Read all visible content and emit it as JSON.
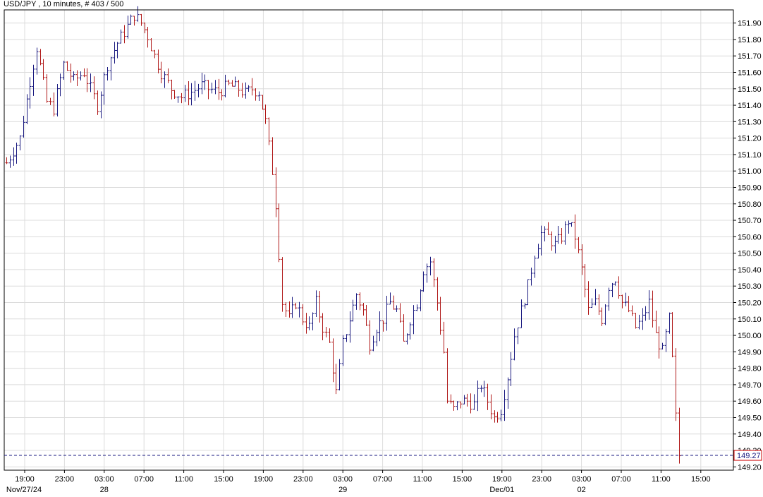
{
  "header": {
    "symbol": "USD/JPY",
    "interval": "10 minutes",
    "count_label": "# 403 / 500",
    "title_text": "USD/JPY , 10 minutes, # 403 / 500"
  },
  "colors": {
    "background": "#ffffff",
    "grid": "#dcdcdc",
    "up_bar": "#1a1a80",
    "down_bar": "#b01818",
    "price_line": "#1a1a80",
    "price_box_border": "#cc0000",
    "price_box_text": "#1a1a80",
    "axis_text": "#000000"
  },
  "current_price": {
    "value": 149.27,
    "label": "149.27"
  },
  "chart_data": {
    "type": "ohlc",
    "title": "USD/JPY , 10 minutes, # 403 / 500",
    "ylim": [
      149.18,
      151.98
    ],
    "y_ticks": [
      151.9,
      151.8,
      151.7,
      151.6,
      151.5,
      151.4,
      151.3,
      151.2,
      151.1,
      151.0,
      150.9,
      150.8,
      150.7,
      150.6,
      150.5,
      150.4,
      150.3,
      150.2,
      150.1,
      150.0,
      149.9,
      149.8,
      149.7,
      149.6,
      149.5,
      149.4,
      149.3,
      149.2
    ],
    "y_tick_labels": [
      "151.90",
      "151.80",
      "151.70",
      "151.60",
      "151.50",
      "151.40",
      "151.30",
      "151.20",
      "151.10",
      "151.00",
      "150.90",
      "150.80",
      "150.70",
      "150.60",
      "150.50",
      "150.40",
      "150.30",
      "150.20",
      "150.10",
      "150.00",
      "149.90",
      "149.80",
      "149.70",
      "149.60",
      "149.50",
      "149.40",
      "149.30",
      "149.20"
    ],
    "x_time_labels": [
      "19:00",
      "23:00",
      "03:00",
      "07:00",
      "11:00",
      "15:00",
      "19:00",
      "23:00",
      "03:00",
      "07:00",
      "11:00",
      "15:00",
      "19:00",
      "23:00",
      "03:00",
      "07:00",
      "11:00",
      "15:00"
    ],
    "x_date_labels": [
      {
        "label": "Nov/27/24",
        "slot": 0
      },
      {
        "label": "28",
        "slot": 2
      },
      {
        "label": "29",
        "slot": 8
      },
      {
        "label": "Dec/01",
        "slot": 12
      },
      {
        "label": "02",
        "slot": 14
      }
    ],
    "grid": true,
    "path": [
      [
        0,
        151.05
      ],
      [
        4,
        151.2
      ],
      [
        7,
        151.55
      ],
      [
        9,
        151.75
      ],
      [
        12,
        151.42
      ],
      [
        14,
        151.38
      ],
      [
        17,
        151.65
      ],
      [
        20,
        151.55
      ],
      [
        23,
        151.6
      ],
      [
        27,
        151.4
      ],
      [
        30,
        151.65
      ],
      [
        33,
        151.78
      ],
      [
        36,
        151.88
      ],
      [
        38,
        151.95
      ],
      [
        40,
        151.9
      ],
      [
        42,
        151.82
      ],
      [
        44,
        151.7
      ],
      [
        46,
        151.6
      ],
      [
        49,
        151.5
      ],
      [
        52,
        151.45
      ],
      [
        55,
        151.48
      ],
      [
        58,
        151.52
      ],
      [
        60,
        151.5
      ],
      [
        63,
        151.48
      ],
      [
        66,
        151.52
      ],
      [
        69,
        151.5
      ],
      [
        71,
        151.47
      ],
      [
        73,
        151.5
      ],
      [
        75,
        151.48
      ],
      [
        77,
        151.3
      ],
      [
        79,
        151.0
      ],
      [
        80,
        150.8
      ],
      [
        81,
        150.5
      ],
      [
        82,
        150.2
      ],
      [
        84,
        150.1
      ],
      [
        86,
        150.2
      ],
      [
        88,
        150.1
      ],
      [
        90,
        150.05
      ],
      [
        92,
        150.2
      ],
      [
        94,
        150.05
      ],
      [
        96,
        149.95
      ],
      [
        98,
        149.65
      ],
      [
        100,
        149.95
      ],
      [
        102,
        150.1
      ],
      [
        104,
        150.25
      ],
      [
        106,
        150.15
      ],
      [
        108,
        149.95
      ],
      [
        110,
        150.05
      ],
      [
        112,
        150.1
      ],
      [
        114,
        150.2
      ],
      [
        116,
        150.15
      ],
      [
        118,
        149.95
      ],
      [
        120,
        150.1
      ],
      [
        122,
        150.2
      ],
      [
        124,
        150.4
      ],
      [
        126,
        150.45
      ],
      [
        128,
        150.2
      ],
      [
        130,
        149.9
      ],
      [
        131,
        149.6
      ],
      [
        133,
        149.55
      ],
      [
        135,
        149.6
      ],
      [
        137,
        149.6
      ],
      [
        139,
        149.58
      ],
      [
        141,
        149.7
      ],
      [
        143,
        149.6
      ],
      [
        145,
        149.5
      ],
      [
        147,
        149.55
      ],
      [
        149,
        149.75
      ],
      [
        151,
        150.0
      ],
      [
        153,
        150.15
      ],
      [
        155,
        150.3
      ],
      [
        157,
        150.5
      ],
      [
        159,
        150.62
      ],
      [
        161,
        150.6
      ],
      [
        163,
        150.55
      ],
      [
        165,
        150.6
      ],
      [
        167,
        150.7
      ],
      [
        169,
        150.6
      ],
      [
        171,
        150.4
      ],
      [
        173,
        150.15
      ],
      [
        175,
        150.2
      ],
      [
        177,
        150.1
      ],
      [
        179,
        150.3
      ],
      [
        181,
        150.35
      ],
      [
        183,
        150.2
      ],
      [
        185,
        150.15
      ],
      [
        187,
        150.05
      ],
      [
        189,
        150.1
      ],
      [
        191,
        150.2
      ],
      [
        193,
        150.0
      ],
      [
        195,
        149.9
      ],
      [
        197,
        150.1
      ],
      [
        198,
        149.85
      ],
      [
        199,
        149.5
      ],
      [
        200,
        149.27
      ]
    ],
    "bars_per_slot": 12
  }
}
